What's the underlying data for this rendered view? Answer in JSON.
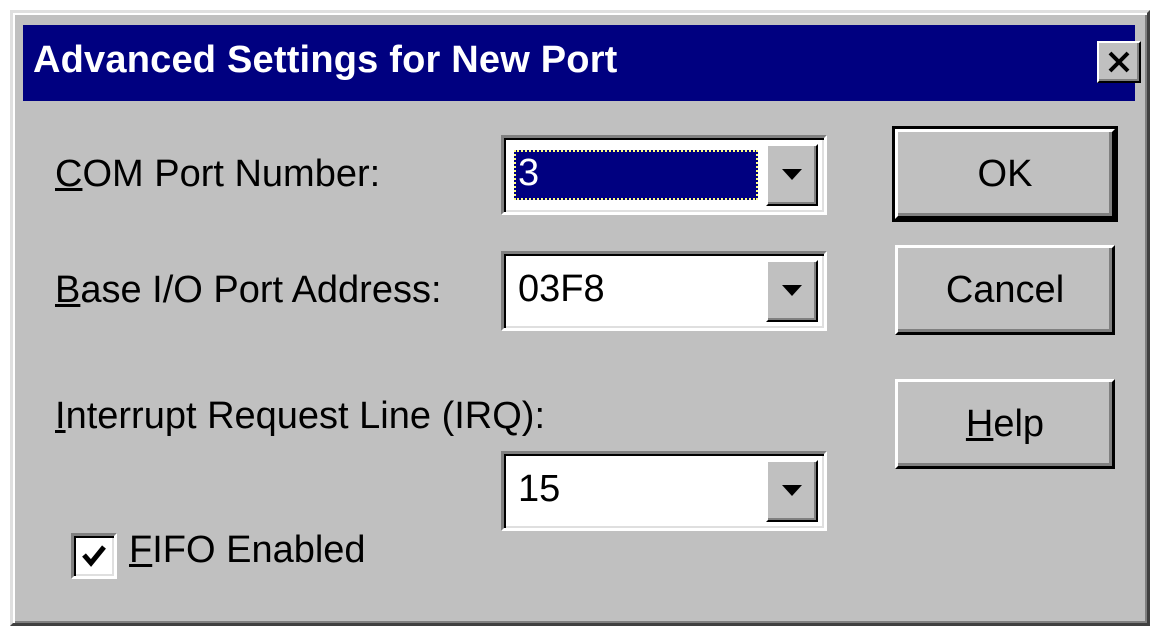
{
  "window": {
    "title": "Advanced Settings for New Port",
    "close_icon": "close-icon"
  },
  "fields": {
    "com_port": {
      "label_mnemonic": "C",
      "label_rest": "OM Port Number:",
      "value": "3"
    },
    "base_io": {
      "label_mnemonic": "B",
      "label_rest": "ase I/O Port Address:",
      "value": "03F8"
    },
    "irq": {
      "label_mnemonic": "I",
      "label_rest": "nterrupt Request Line (IRQ):",
      "value": "15"
    },
    "fifo": {
      "label_mnemonic": "F",
      "label_rest": "IFO Enabled",
      "checked": true
    }
  },
  "buttons": {
    "ok": "OK",
    "cancel": "Cancel",
    "help_mnemonic": "H",
    "help_rest": "elp"
  },
  "icons": {
    "dropdown": "chevron-down-icon",
    "checkmark": "checkmark-icon"
  },
  "colors": {
    "title_bar": "#000080",
    "dialog_face": "#c0c0c0",
    "selection": "#000080"
  }
}
